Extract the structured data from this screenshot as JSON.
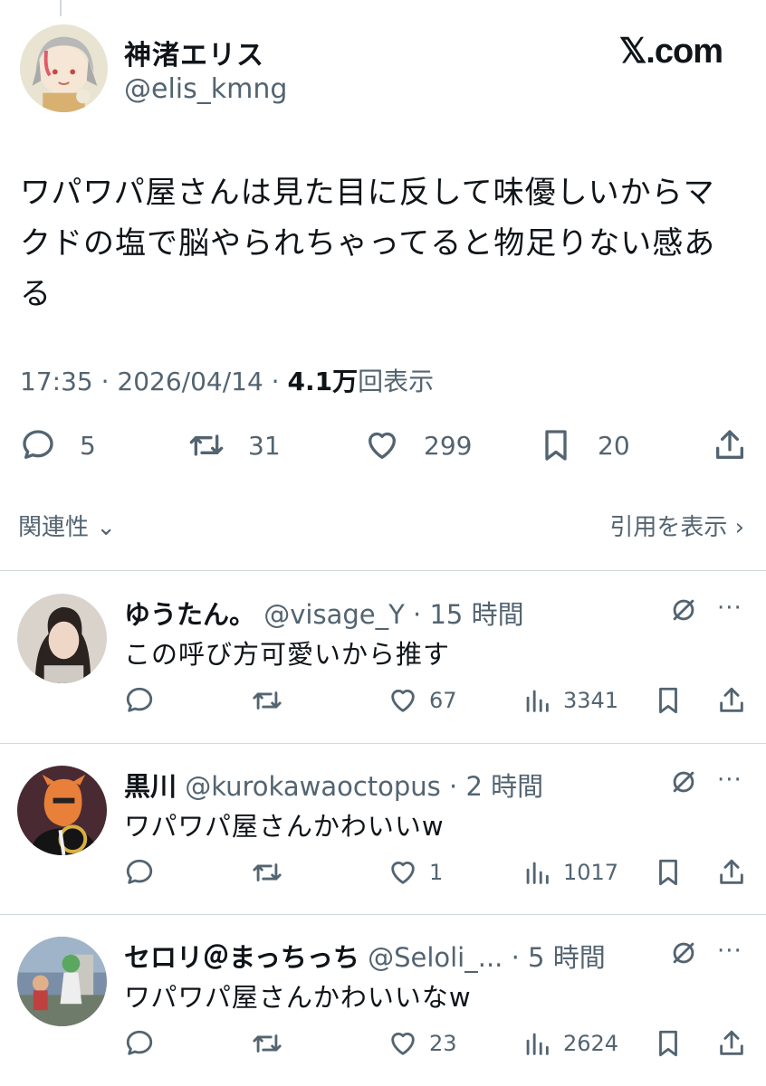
{
  "brand": "𝕏.com",
  "tweet": {
    "author_name": "神渚エリス",
    "author_handle": "@elis_kmng",
    "text_lines": [
      "ワパワパ屋さんは見た目に反して味優しいからマ",
      "クドの塩で脳やられちゃってると物足りない感あ",
      "る"
    ],
    "time": "17:35 · 2026/04/14 · ",
    "views": "4.1万",
    "views_label": "回表示",
    "replies": "5",
    "retweets": "31",
    "likes": "299",
    "bookmarks": "20"
  },
  "related_label": "関連性 ",
  "related_chevron": "⌄",
  "quotes_label": "引用を表示 ",
  "quotes_chevron": "›",
  "replies": [
    {
      "name": "ゆうたん。",
      "handle": "@visage_Y",
      "sep": " · ",
      "time": "15 時間",
      "text": "この呼び方可愛いから推す",
      "likes": "67",
      "views": "3341",
      "more": "···"
    },
    {
      "name": "黒川",
      "handle": "@kurokawaoctopus",
      "sep": " · ",
      "time": "2 時間",
      "text": "ワパワパ屋さんかわいいw",
      "likes": "1",
      "views": "1017",
      "more": "···"
    },
    {
      "name": "セロリ＠まっちっち",
      "handle": "@Seloli_...",
      "sep": " · ",
      "time": "5 時間",
      "text": "ワパワパ屋さんかわいいなw",
      "likes": "23",
      "views": "2624",
      "more": "···"
    }
  ],
  "icons": {
    "reply": "reply-icon",
    "retweet": "retweet-icon",
    "like": "heart-icon",
    "bookmark": "bookmark-icon",
    "share": "share-icon",
    "views": "analytics-icon",
    "grok": "grok-icon"
  },
  "colors": {
    "text": "#0f1419",
    "secondary": "#536471",
    "divider": "#cfd9de"
  }
}
